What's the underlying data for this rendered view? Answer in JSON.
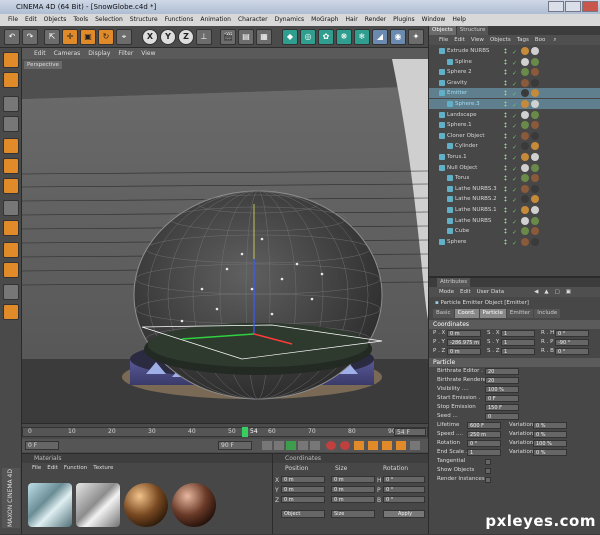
{
  "window": {
    "title": "CINEMA 4D (64 Bit) - [SnowGlobe.c4d *]"
  },
  "menu": [
    "File",
    "Edit",
    "Objects",
    "Tools",
    "Selection",
    "Structure",
    "Functions",
    "Animation",
    "Character",
    "Dynamics",
    "MoGraph",
    "Hair",
    "Render",
    "Plugins",
    "Window",
    "Help"
  ],
  "toolbar": {
    "axis_x": "X",
    "axis_y": "Y",
    "axis_z": "Z"
  },
  "viewport": {
    "menu": [
      "Edit",
      "Cameras",
      "Display",
      "Filter",
      "View"
    ],
    "label": "Perspective"
  },
  "timeline": {
    "ticks": [
      "0",
      "10",
      "20",
      "30",
      "40",
      "50",
      "54",
      "60",
      "70",
      "80",
      "90"
    ],
    "current_frame": "54 F",
    "start_field": "0 F",
    "end_field": "90 F"
  },
  "objects_panel": {
    "tabs": [
      "Objects",
      "Structure"
    ],
    "menu": [
      "File",
      "Edit",
      "View",
      "Objects",
      "Tags",
      "Boo"
    ],
    "items": [
      {
        "name": "Extrude NURBS",
        "indent": 0
      },
      {
        "name": "Spline",
        "indent": 1
      },
      {
        "name": "Sphere 2",
        "indent": 0
      },
      {
        "name": "Gravity",
        "indent": 0
      },
      {
        "name": "Emitter",
        "indent": 0,
        "highlight": true
      },
      {
        "name": "Sphere.3",
        "indent": 1,
        "highlight": true
      },
      {
        "name": "Landscape",
        "indent": 0
      },
      {
        "name": "Sphere.1",
        "indent": 0
      },
      {
        "name": "Cloner Object",
        "indent": 0
      },
      {
        "name": "Cylinder",
        "indent": 1
      },
      {
        "name": "Torus.1",
        "indent": 0
      },
      {
        "name": "Null Object",
        "indent": 0
      },
      {
        "name": "Torus",
        "indent": 1
      },
      {
        "name": "Lathe NURBS.3",
        "indent": 1
      },
      {
        "name": "Lathe NURBS.2",
        "indent": 1
      },
      {
        "name": "Lathe NURBS.1",
        "indent": 1
      },
      {
        "name": "Lathe NURBS",
        "indent": 1
      },
      {
        "name": "Cube",
        "indent": 1
      },
      {
        "name": "Sphere",
        "indent": 0
      }
    ]
  },
  "attributes": {
    "tab_label": "Attributes",
    "menu": [
      "Mode",
      "Edit",
      "User Data"
    ],
    "object_title": "Particle Emitter Object [Emitter]",
    "tabs": [
      "Basic",
      "Coord.",
      "Particle",
      "Emitter",
      "Include"
    ],
    "coordinates_header": "Coordinates",
    "coords": [
      {
        "a": "P . X",
        "av": "0 m",
        "b": "S . X",
        "bv": "1",
        "c": "R . H",
        "cv": "0 °"
      },
      {
        "a": "P . Y",
        "av": "-286.975 m",
        "b": "S . Y",
        "bv": "1",
        "c": "R . P",
        "cv": "-90 °"
      },
      {
        "a": "P . Z",
        "av": "0 m",
        "b": "S . Z",
        "bv": "1",
        "c": "R . B",
        "cv": "0 °"
      }
    ],
    "particle_header": "Particle",
    "particle": [
      {
        "label": "Birthrate Editor .",
        "value": "20"
      },
      {
        "label": "Birthrate Renderer",
        "value": "20"
      },
      {
        "label": "Visibility ....",
        "value": "100 %"
      },
      {
        "label": "Start Emission .",
        "value": "0 F"
      },
      {
        "label": "Stop Emission",
        "value": "150 F"
      },
      {
        "label": "Seed ...",
        "value": "0"
      }
    ],
    "particle_pairs": [
      {
        "label": "Lifetime",
        "value": "600 F",
        "var": "Variation",
        "vval": "0 %"
      },
      {
        "label": "Speed ....",
        "value": "250 m",
        "var": "Variation",
        "vval": "0 %"
      },
      {
        "label": "Rotation",
        "value": "0 °",
        "var": "Variation",
        "vval": "100 %"
      },
      {
        "label": "End Scale .",
        "value": "1",
        "var": "Variation",
        "vval": "0 %"
      }
    ],
    "checks": [
      "Tangential",
      "Show Objects",
      "Render Instances"
    ]
  },
  "materials": {
    "title": "Materials",
    "menu": [
      "File",
      "Edit",
      "Function",
      "Texture"
    ]
  },
  "coordinates_panel": {
    "title": "Coordinates",
    "headers": [
      "Position",
      "Size",
      "Rotation"
    ],
    "rows": [
      {
        "axis": "X",
        "pos": "0 m",
        "size": "0 m",
        "rl": "H",
        "rot": "0 °"
      },
      {
        "axis": "Y",
        "pos": "0 m",
        "size": "0 m",
        "rl": "P",
        "rot": "0 °"
      },
      {
        "axis": "Z",
        "pos": "0 m",
        "size": "0 m",
        "rl": "B",
        "rot": "0 °"
      }
    ],
    "mode": "Object",
    "size_mode": "Size",
    "apply": "Apply"
  },
  "brand": {
    "logo_text": "MAXON CINEMA 4D",
    "watermark": "pxleyes.com"
  },
  "colors": {
    "accent": "#e08a2a",
    "highlight": "#62b0c8",
    "panel": "#474747"
  }
}
